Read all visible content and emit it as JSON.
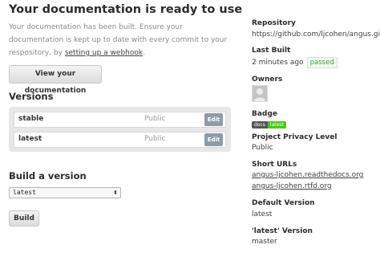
{
  "main": {
    "title": "Your documentation is ready to use",
    "intro_text": "Your documentation has been built. Ensure your documentation is kept up to date with every commit to your respository, by ",
    "intro_link": "setting up a webhook",
    "intro_end": ".",
    "view_docs_label": "View your documentation",
    "versions_title": "Versions",
    "versions": [
      {
        "name": "stable",
        "privacy": "Public",
        "edit_label": "Edit"
      },
      {
        "name": "latest",
        "privacy": "Public",
        "edit_label": "Edit"
      }
    ],
    "build_title": "Build a version",
    "build_select_value": "latest",
    "build_button_label": "Build"
  },
  "sidebar": {
    "repository_label": "Repository",
    "repository_url": "https://github.com/ljcohen/angus.git",
    "last_built_label": "Last Built",
    "last_built_value": "2 minutes ago",
    "status": "passed",
    "owners_label": "Owners",
    "badge_label": "Badge",
    "badge_left": "docs",
    "badge_right": "latest",
    "privacy_label": "Project Privacy Level",
    "privacy_value": "Public",
    "short_urls_label": "Short URLs",
    "short_urls": [
      "angus-ljcohen.readthedocs.org",
      "angus-ljcohen.rtfd.org"
    ],
    "default_version_label": "Default Version",
    "default_version_value": "latest",
    "latest_version_label": "'latest' Version",
    "latest_version_value": "master"
  },
  "colors": {
    "passed": "#3f9b3f",
    "badge_green": "#44cc11",
    "edit_button": "#8f9ba6"
  }
}
